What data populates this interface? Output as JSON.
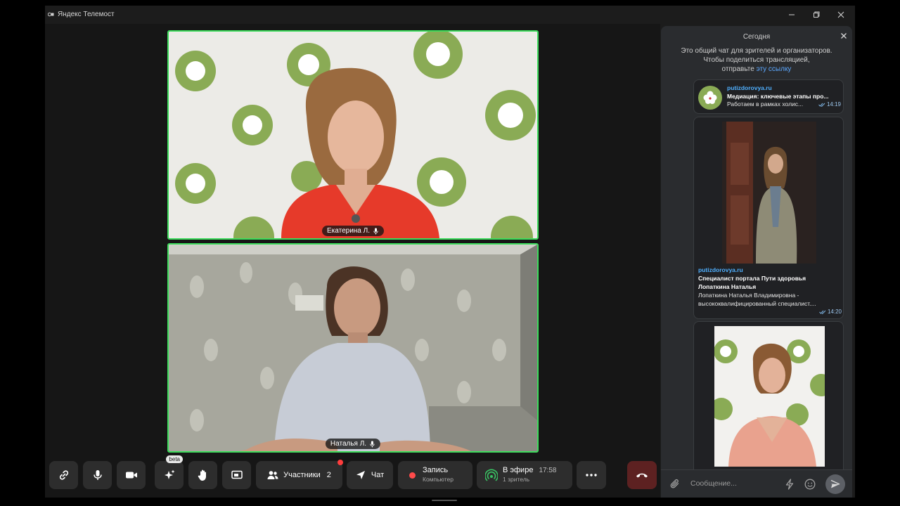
{
  "window": {
    "title": "Яндекс Телемост"
  },
  "participants": [
    {
      "name": "Екатерина Л."
    },
    {
      "name": "Наталья Л."
    }
  ],
  "toolbar": {
    "ai_badge": "beta",
    "participants_label": "Участники",
    "participants_count": "2",
    "chat_label": "Чат",
    "record_label": "Запись",
    "record_sub": "Компьютер",
    "live_label": "В эфире",
    "live_time": "17:58",
    "live_sub": "1 зритель"
  },
  "chat": {
    "date_header": "Сегодня",
    "info_line1": "Это общий чат для зрителей и организаторов.",
    "info_line2": "Чтобы поделиться трансляцией,",
    "info_line3_prefix": "отправьте",
    "info_link": "эту ссылку",
    "messages": [
      {
        "site": "putizdorovya.ru",
        "title": "Медиация: ключевые этапы про...",
        "text": "Работаем в рамках холис...",
        "time": "14:19"
      },
      {
        "site": "putizdorovya.ru",
        "title_line1": "Специалист портала Пути здоровья",
        "title_line2": "Лопаткина Наталья",
        "text_line1": "Лопаткина Наталья Владимировна -",
        "text_line2": "высококвалифицированный специалист....",
        "time": "14:20"
      }
    ],
    "input_placeholder": "Сообщение..."
  },
  "colors": {
    "speaker_border": "#3ddc5c",
    "link": "#5ca8ff",
    "record_dot": "#ff4b4b",
    "hangup": "#5d2121"
  }
}
